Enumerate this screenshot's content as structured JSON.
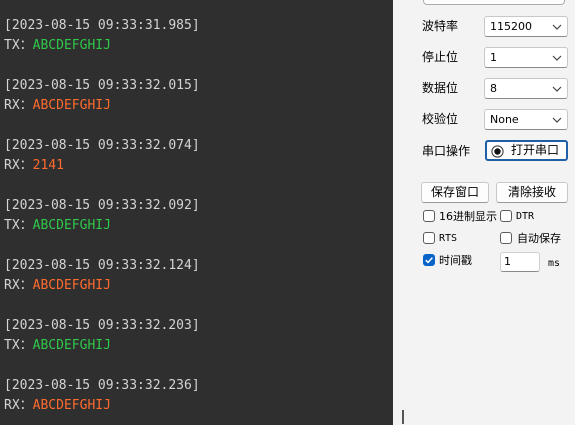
{
  "log": [
    {
      "timestamp": "[2023-08-15 09:33:31.985]",
      "dir": "TX：",
      "data": "ABCDEFGHIJ",
      "kind": "tx"
    },
    {
      "timestamp": "[2023-08-15 09:33:32.015]",
      "dir": "RX：",
      "data": "ABCDEFGHIJ",
      "kind": "rx"
    },
    {
      "timestamp": "[2023-08-15 09:33:32.074]",
      "dir": "RX：",
      "data": "2141",
      "kind": "rx"
    },
    {
      "timestamp": "[2023-08-15 09:33:32.092]",
      "dir": "TX：",
      "data": "ABCDEFGHIJ",
      "kind": "tx"
    },
    {
      "timestamp": "[2023-08-15 09:33:32.124]",
      "dir": "RX：",
      "data": "ABCDEFGHIJ",
      "kind": "rx"
    },
    {
      "timestamp": "[2023-08-15 09:33:32.203]",
      "dir": "TX：",
      "data": "ABCDEFGHIJ",
      "kind": "tx"
    },
    {
      "timestamp": "[2023-08-15 09:33:32.236]",
      "dir": "RX：",
      "data": "ABCDEFGHIJ",
      "kind": "rx"
    }
  ],
  "settings": {
    "baud": {
      "label": "波特率",
      "value": "115200"
    },
    "stopbits": {
      "label": "停止位",
      "value": "1"
    },
    "databits": {
      "label": "数据位",
      "value": "8"
    },
    "parity": {
      "label": "校验位",
      "value": "None"
    },
    "port_op": {
      "label": "串口操作",
      "button": "打开串口"
    }
  },
  "actions": {
    "save_window": "保存窗口",
    "clear_receive": "清除接收"
  },
  "options": {
    "hex_display": {
      "label": "16进制显示",
      "checked": false
    },
    "dtr": {
      "label": "DTR",
      "checked": false
    },
    "rts": {
      "label": "RTS",
      "checked": false
    },
    "auto_save": {
      "label": "自动保存",
      "checked": false
    },
    "timestamp": {
      "label": "时间戳",
      "checked": true,
      "value": "1",
      "unit": "ms"
    }
  },
  "colors": {
    "tx": "#2ec84a",
    "rx": "#ff6b2e",
    "log_bg": "#2f2f2f"
  }
}
